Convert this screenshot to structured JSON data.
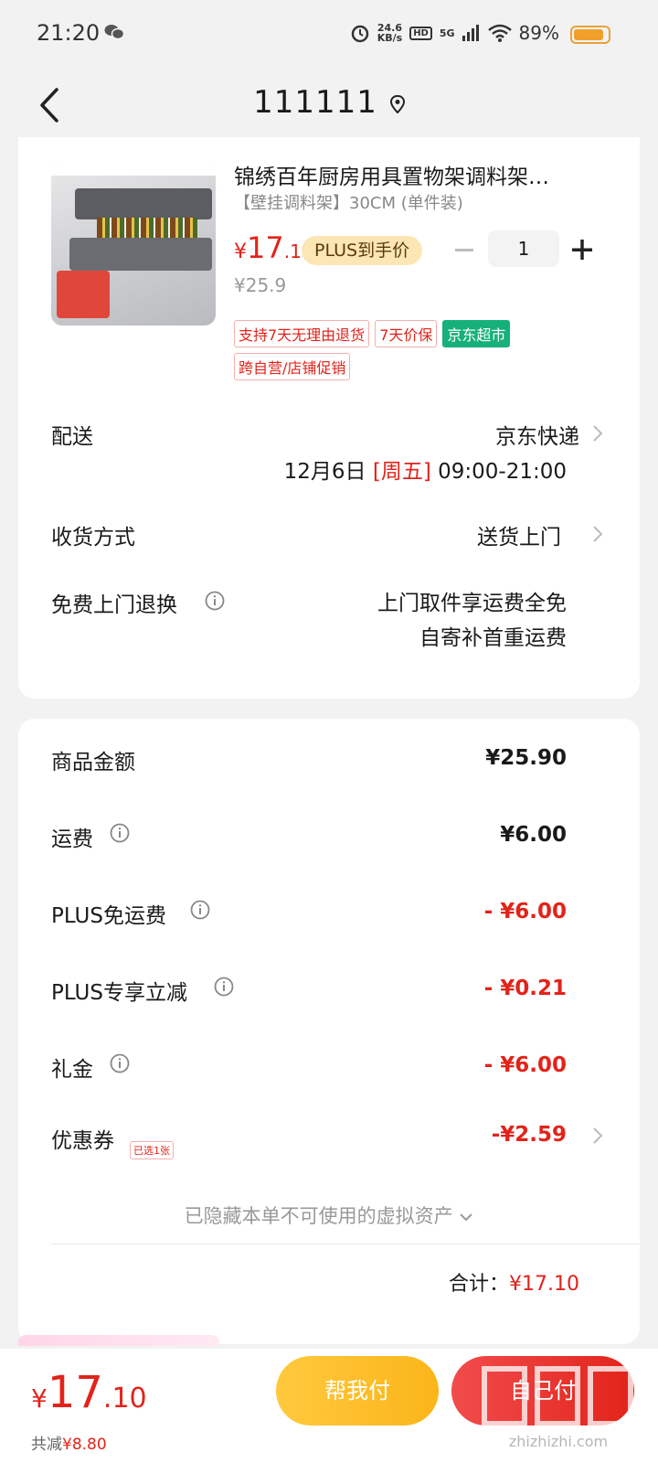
{
  "status_bar": {
    "time": "21:20",
    "net_speed_value": "24.6",
    "net_speed_unit": "KB/s",
    "hd_label": "HD",
    "network": "5G",
    "battery_percent": "89%",
    "battery_level": 0.89
  },
  "header": {
    "title": "111111"
  },
  "product": {
    "name": "锦绣百年厨房用具置物架调料架…",
    "spec": "【壁挂调料架】30CM (单件装)",
    "price_symbol": "¥",
    "price_int": "17",
    "price_dec": ".1",
    "plus_badge": "PLUS到手价",
    "original_price": "¥25.9",
    "quantity": "1",
    "tags_row1": [
      "支持7天无理由退货",
      "7天价保",
      "京东超市"
    ],
    "tags_row2": [
      "跨自营/店铺促销"
    ]
  },
  "delivery": {
    "label": "配送",
    "carrier": "京东快递",
    "date": "12月6日",
    "weekday": "[周五]",
    "time_window": "09:00-21:00"
  },
  "receive": {
    "label": "收货方式",
    "value": "送货上门"
  },
  "free_return": {
    "label": "免费上门退换",
    "line1": "上门取件享运费全免",
    "line2": "自寄补首重运费"
  },
  "summary": {
    "items": [
      {
        "label": "商品金额",
        "value": "¥25.90"
      },
      {
        "label": "运费",
        "value": "¥6.00"
      },
      {
        "label": "PLUS免运费",
        "value": "- ¥6.00"
      },
      {
        "label": "PLUS专享立减",
        "value": "- ¥0.21"
      },
      {
        "label": "礼金",
        "value": "- ¥6.00"
      },
      {
        "label": "优惠券",
        "value": "-¥2.59"
      }
    ],
    "coupon_badge": "已选1张",
    "hidden_assets": "已隐藏本单不可使用的虚拟资产",
    "total_label": "合计：",
    "total_value": "¥17.10"
  },
  "bottom": {
    "price_symbol": "¥",
    "price_int": "17",
    "price_dec": ".10",
    "saved_label": "共减",
    "saved_value": "¥8.80",
    "help_pay": "帮我付",
    "self_pay": "自己付",
    "watermark": "值 什么值得买",
    "watermark_url": "zhizhizhi.com"
  },
  "colors": {
    "accent_red": "#e2231a",
    "plus_gold": "#fce6b4",
    "jd_green": "#17b07a",
    "help_yellow": "#fbb51a"
  }
}
